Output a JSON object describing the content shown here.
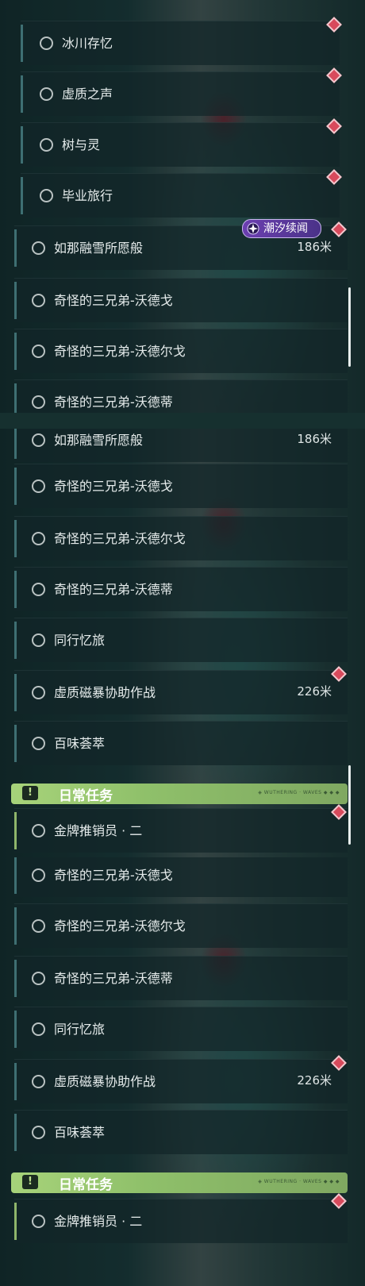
{
  "panels": [
    {
      "rows": [
        {
          "label": "冰川存忆",
          "marker": true
        },
        {
          "label": "虚质之声",
          "marker": true
        },
        {
          "label": "树与灵",
          "marker": true
        },
        {
          "label": "毕业旅行",
          "marker": true
        },
        {
          "label": "如那融雪所愿般",
          "distance": "186米",
          "marker": true,
          "badge": "潮汐续闻"
        },
        {
          "label": "奇怪的三兄弟-沃德戈"
        },
        {
          "label": "奇怪的三兄弟-沃德尔戈"
        },
        {
          "label": "奇怪的三兄弟-沃德蒂"
        }
      ]
    },
    {
      "rows": [
        {
          "label": "如那融雪所愿般",
          "distance": "186米"
        },
        {
          "label": "奇怪的三兄弟-沃德戈"
        },
        {
          "label": "奇怪的三兄弟-沃德尔戈"
        },
        {
          "label": "奇怪的三兄弟-沃德蒂"
        },
        {
          "label": "同行忆旅"
        },
        {
          "label": "虚质磁暴协助作战",
          "distance": "226米",
          "marker": true
        },
        {
          "label": "百味荟萃"
        }
      ],
      "section": {
        "title": "日常任务",
        "tag": "◈ WUTHERING · WAVES ◆ ◆ ◆"
      },
      "daily": [
        {
          "label": "金牌推销员 · 二",
          "marker": true
        }
      ]
    },
    {
      "rows": [
        {
          "label": "奇怪的三兄弟-沃德戈"
        },
        {
          "label": "奇怪的三兄弟-沃德尔戈"
        },
        {
          "label": "奇怪的三兄弟-沃德蒂"
        },
        {
          "label": "同行忆旅"
        },
        {
          "label": "虚质磁暴协助作战",
          "distance": "226米",
          "marker": true
        },
        {
          "label": "百味荟萃"
        }
      ],
      "section": {
        "title": "日常任务",
        "tag": "◈ WUTHERING · WAVES ◆ ◆ ◆"
      },
      "daily": [
        {
          "label": "金牌推销员 · 二",
          "marker": true
        }
      ]
    }
  ]
}
